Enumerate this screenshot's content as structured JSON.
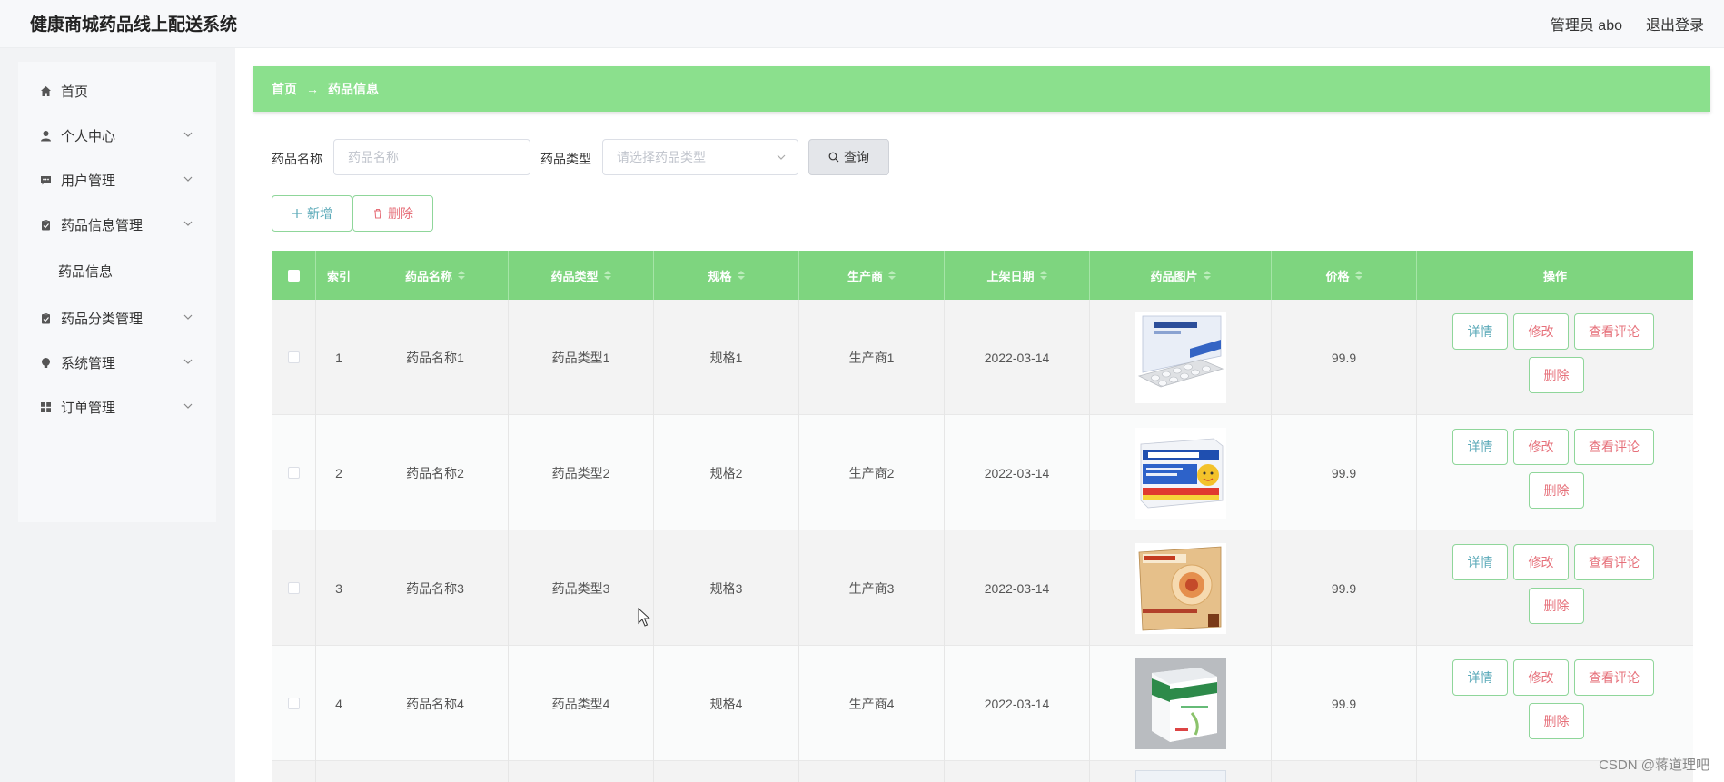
{
  "header": {
    "title": "健康商城药品线上配送系统",
    "user": "管理员 abo",
    "logout": "退出登录"
  },
  "sidebar": {
    "items": [
      {
        "label": "首页",
        "icon": "home-icon",
        "expandable": false
      },
      {
        "label": "个人中心",
        "icon": "user-icon",
        "expandable": true
      },
      {
        "label": "用户管理",
        "icon": "chat-icon",
        "expandable": true
      },
      {
        "label": "药品信息管理",
        "icon": "clipboard-icon",
        "expandable": true
      },
      {
        "label": "药品分类管理",
        "icon": "clipboard-icon",
        "expandable": true
      },
      {
        "label": "系统管理",
        "icon": "bulb-icon",
        "expandable": true
      },
      {
        "label": "订单管理",
        "icon": "grid-icon",
        "expandable": true
      }
    ],
    "subitem": "药品信息"
  },
  "breadcrumb": {
    "home": "首页",
    "separator": "→",
    "current": "药品信息"
  },
  "filters": {
    "name_label": "药品名称",
    "name_placeholder": "药品名称",
    "type_label": "药品类型",
    "type_placeholder": "请选择药品类型",
    "query_label": "查询"
  },
  "actions": {
    "add_label": "新增",
    "delete_label": "删除"
  },
  "table": {
    "columns": [
      "索引",
      "药品名称",
      "药品类型",
      "规格",
      "生产商",
      "上架日期",
      "药品图片",
      "价格",
      "操作"
    ],
    "rows": [
      {
        "index": "1",
        "name": "药品名称1",
        "type": "药品类型1",
        "spec": "规格1",
        "maker": "生产商1",
        "date": "2022-03-14",
        "price": "99.9"
      },
      {
        "index": "2",
        "name": "药品名称2",
        "type": "药品类型2",
        "spec": "规格2",
        "maker": "生产商2",
        "date": "2022-03-14",
        "price": "99.9"
      },
      {
        "index": "3",
        "name": "药品名称3",
        "type": "药品类型3",
        "spec": "规格3",
        "maker": "生产商3",
        "date": "2022-03-14",
        "price": "99.9"
      },
      {
        "index": "4",
        "name": "药品名称4",
        "type": "药品类型4",
        "spec": "规格4",
        "maker": "生产商4",
        "date": "2022-03-14",
        "price": "99.9"
      }
    ],
    "ops": {
      "detail": "详情",
      "edit": "修改",
      "comment": "查看评论",
      "delete": "删除"
    }
  },
  "watermark": "CSDN @蒋道理吧",
  "colors": {
    "accent_green": "#7ed57f",
    "breadcrumb_green": "#8be08d",
    "detail_text": "#5aa9b8",
    "danger_text": "#e6707a"
  }
}
